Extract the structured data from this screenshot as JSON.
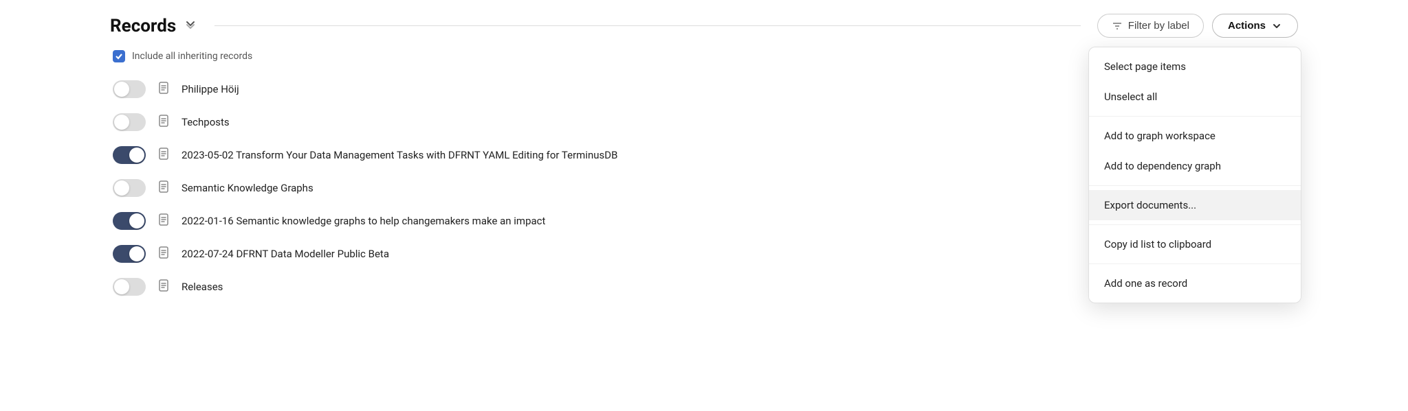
{
  "header": {
    "title": "Records",
    "sort_icon": "≫",
    "filter_placeholder": "Filter by label",
    "actions_label": "Actions",
    "chevron": "▾"
  },
  "checkbox": {
    "label": "Include all inheriting records"
  },
  "records": [
    {
      "id": 1,
      "name": "Philippe Höij",
      "toggled": false
    },
    {
      "id": 2,
      "name": "Techposts",
      "toggled": false
    },
    {
      "id": 3,
      "name": "2023-05-02 Transform Your Data Management Tasks with DFRNT YAML Editing for TerminusDB",
      "toggled": true
    },
    {
      "id": 4,
      "name": "Semantic Knowledge Graphs",
      "toggled": false
    },
    {
      "id": 5,
      "name": "2022-01-16 Semantic knowledge graphs to help changemakers make an impact",
      "toggled": true
    },
    {
      "id": 6,
      "name": "2022-07-24 DFRNT Data Modeller Public Beta",
      "toggled": true
    },
    {
      "id": 7,
      "name": "Releases",
      "toggled": false
    }
  ],
  "dropdown": {
    "sections": [
      {
        "items": [
          {
            "id": "select-page",
            "label": "Select page items"
          },
          {
            "id": "unselect-all",
            "label": "Unselect all"
          }
        ]
      },
      {
        "items": [
          {
            "id": "add-to-graph",
            "label": "Add to graph workspace"
          },
          {
            "id": "add-to-dependency",
            "label": "Add to dependency graph"
          }
        ]
      },
      {
        "items": [
          {
            "id": "export-docs",
            "label": "Export documents...",
            "highlighted": true
          }
        ]
      },
      {
        "items": [
          {
            "id": "copy-id-list",
            "label": "Copy id list to clipboard"
          }
        ]
      },
      {
        "items": [
          {
            "id": "add-one-record",
            "label": "Add one as record"
          }
        ]
      }
    ]
  }
}
